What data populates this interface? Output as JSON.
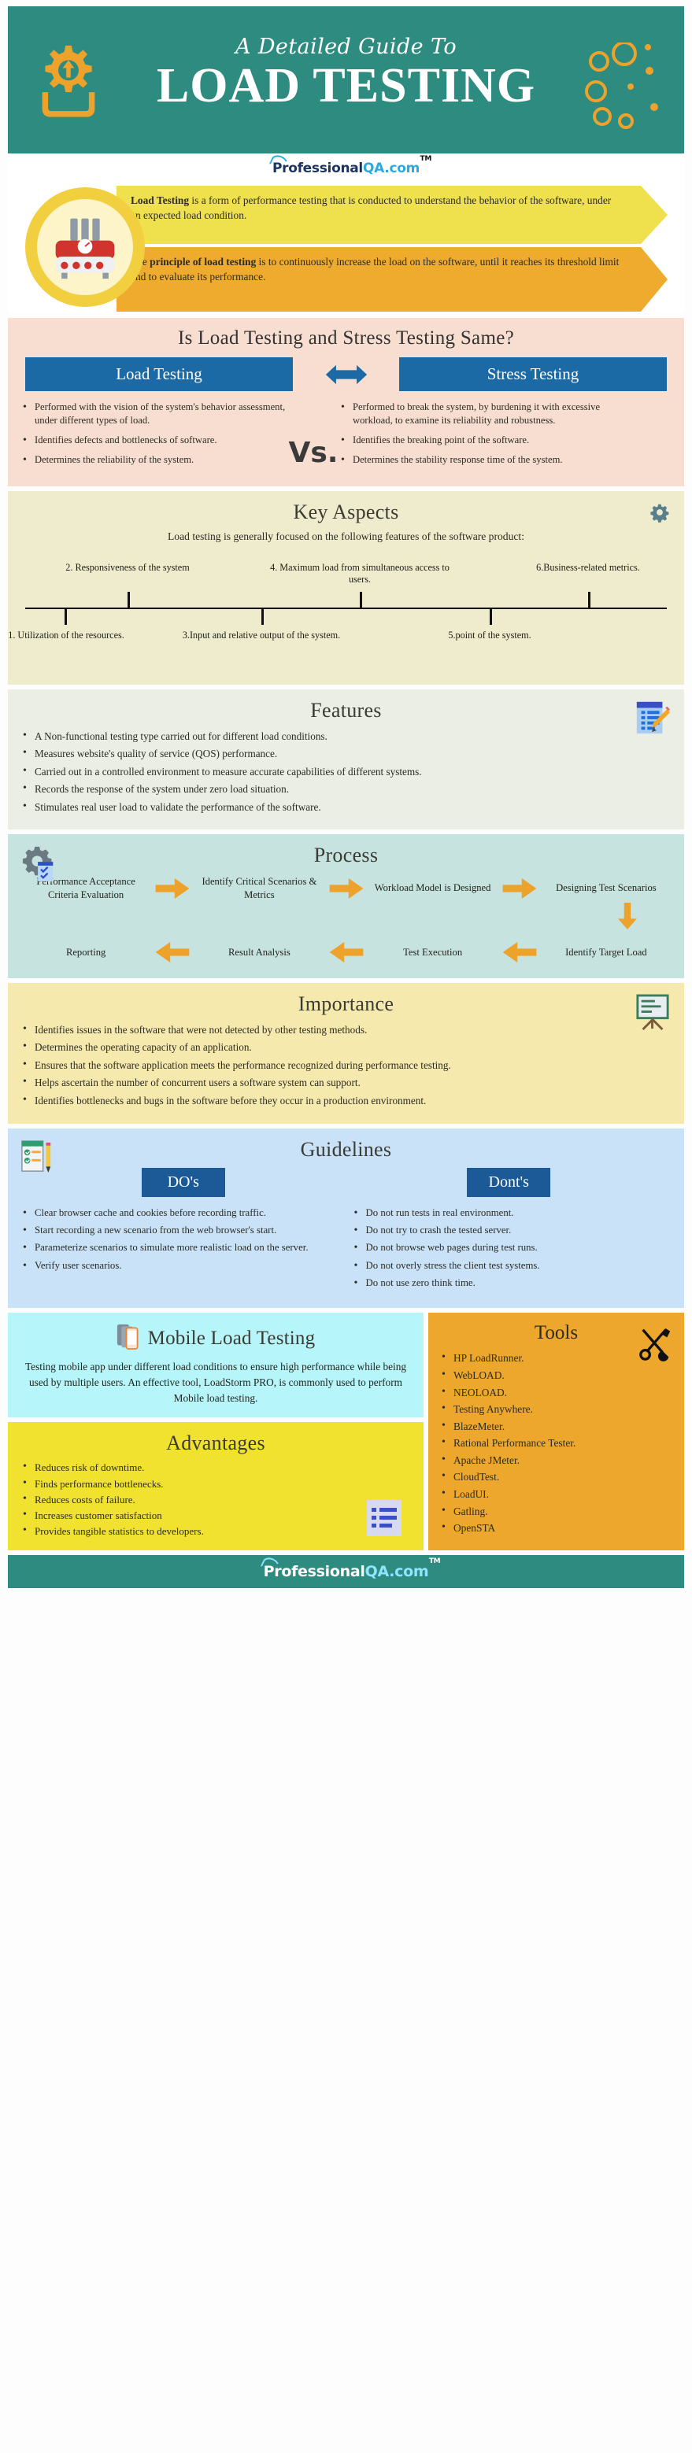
{
  "header": {
    "subtitle": "A Detailed Guide To",
    "title": "LOAD TESTING",
    "gear_icon": "gear-download-icon",
    "bubbles_icon": "circles-decoration-icon"
  },
  "brand": {
    "dark_part": "Professional",
    "blue_part": "QA.com",
    "tm": "TM"
  },
  "definition": {
    "icon": "server-load-icon",
    "banner1_lead": "Load Testing",
    "banner1_rest": " is a form of performance testing that is conducted to understand the behavior of the software, under an expected load condition.",
    "banner2_pre": "The ",
    "banner2_lead": "principle of load testing",
    "banner2_rest": " is to continuously increase the load on the software, until it reaches its threshold limit and to evaluate its performance.",
    "color_banner1": "#efe04e",
    "color_banner2": "#eeab2e"
  },
  "comparison": {
    "title": "Is Load Testing and Stress Testing Same?",
    "left_label": "Load Testing",
    "right_label": "Stress Testing",
    "vs_word": "Vs.",
    "arrow_icon": "double-arrow-icon",
    "pill_color": "#1b6aa5",
    "left_points": [
      "Performed with the vision of the system's behavior assessment, under different types of load.",
      "Identifies defects and bottlenecks of software.",
      "Determines the reliability of the system."
    ],
    "right_points": [
      "Performed to break the system, by burdening it with excessive workload, to examine its reliability and robustness.",
      "Identifies the breaking point of the software.",
      "Determines the stability response time of the system."
    ]
  },
  "key_aspects": {
    "title": "Key Aspects",
    "icon": "gear-icon",
    "intro": "Load testing is generally focused on the following features of the software product:",
    "items_top": [
      "2. Responsiveness of the system",
      "4. Maximum load from simultaneous access to users.",
      "6.Business-related metrics."
    ],
    "items_bottom": [
      "1. Utilization of the resources.",
      "3.Input and relative output of the system.",
      "5.point of the system."
    ]
  },
  "features": {
    "title": "Features",
    "icon": "notepad-pencil-icon",
    "items": [
      "A Non-functional testing type carried out for different load conditions.",
      "Measures website's quality of service (QOS) performance.",
      "Carried out in a controlled environment to measure accurate capabilities of different systems.",
      "Records the response of the system under zero load situation.",
      "Stimulates real user load to validate the performance of the software."
    ]
  },
  "process": {
    "title": "Process",
    "icon": "gear-checklist-icon",
    "arrow_icon": "right-arrow-icon",
    "arrow_left_icon": "left-arrow-icon",
    "arrow_down_icon": "down-arrow-icon",
    "arrow_color": "#eda22c",
    "row1": [
      "Performance Acceptance Criteria Evaluation",
      "Identify Critical Scenarios & Metrics",
      "Workload Model is Designed",
      "Designing Test Scenarios"
    ],
    "row2": [
      "Reporting",
      "Result Analysis",
      "Test Execution",
      "Identify Target Load"
    ]
  },
  "importance": {
    "title": "Importance",
    "icon": "presentation-board-icon",
    "items": [
      "Identifies issues in the software that were not detected by other testing methods.",
      "Determines the operating capacity of an application.",
      "Ensures that the software application meets the performance recognized during performance testing.",
      "Helps ascertain the number of concurrent users a software system can support.",
      "Identifies bottlenecks and bugs in the software before they occur in a production environment."
    ]
  },
  "guidelines": {
    "title": "Guidelines",
    "icon": "checklist-pencil-icon",
    "dos_label": "DO's",
    "donts_label": "Dont's",
    "dos": [
      "Clear browser cache and cookies before recording traffic.",
      "Start recording a new scenario from the web browser's start.",
      "Parameterize scenarios to simulate more realistic load on the server.",
      "Verify user scenarios."
    ],
    "donts": [
      "Do not run tests in real environment.",
      "Do not try to crash the tested server.",
      "Do not browse web pages during test runs.",
      "Do not overly stress the client test systems.",
      "Do not use zero think time."
    ]
  },
  "mobile": {
    "title": "Mobile Load Testing",
    "icon": "mobile-phones-icon",
    "text": "Testing mobile app under different load conditions to ensure high performance while being used by multiple users. An effective tool, LoadStorm PRO, is commonly used to perform Mobile load testing."
  },
  "advantages": {
    "title": "Advantages",
    "icon": "report-list-icon",
    "items": [
      "Reduces risk of downtime.",
      "Finds performance bottlenecks.",
      "Reduces costs of failure.",
      "Increases customer satisfaction",
      "Provides tangible statistics to developers."
    ]
  },
  "tools": {
    "title": "Tools",
    "icon": "wrench-screwdriver-icon",
    "items": [
      "HP LoadRunner.",
      "WebLOAD.",
      "NEOLOAD.",
      "Testing Anywhere.",
      "BlazeMeter.",
      "Rational Performance Tester.",
      "Apache JMeter.",
      "CloudTest.",
      "LoadUI.",
      "Gatling.",
      "OpenSTA"
    ]
  },
  "theme": {
    "teal": "#2e8b7f",
    "orange": "#eda22c",
    "blue": "#1b6aa5"
  }
}
